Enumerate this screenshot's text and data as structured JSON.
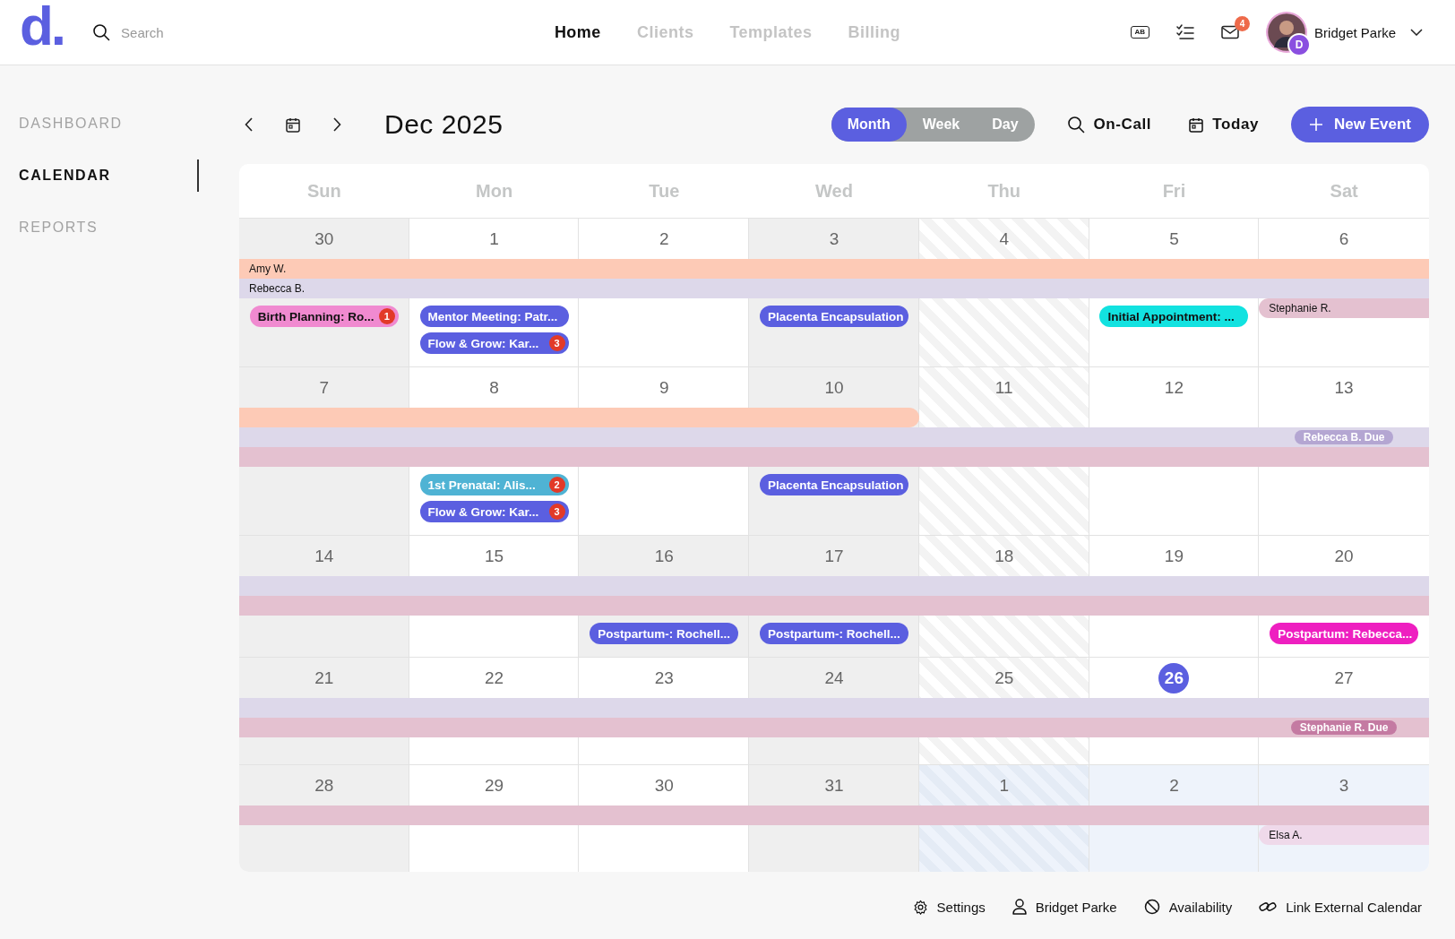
{
  "header": {
    "logo": "d.",
    "search": {
      "placeholder": "Search"
    },
    "nav": [
      {
        "label": "Home",
        "selected": true
      },
      {
        "label": "Clients",
        "selected": false
      },
      {
        "label": "Templates",
        "selected": false
      },
      {
        "label": "Billing",
        "selected": false
      }
    ],
    "tools": [
      {
        "kind": "caption",
        "text": "AB"
      },
      {
        "kind": "checklist"
      },
      {
        "kind": "mail",
        "badge": "4"
      }
    ],
    "user": {
      "initial": "D",
      "name": "Bridget Parke"
    }
  },
  "sidebar": {
    "items": [
      {
        "label": "DASHBOARD",
        "selected": false
      },
      {
        "label": "CALENDAR",
        "selected": true
      },
      {
        "label": "REPORTS",
        "selected": false
      }
    ]
  },
  "toolbar": {
    "title": "Dec 2025",
    "views": [
      {
        "label": "Month",
        "selected": true
      },
      {
        "label": "Week",
        "selected": false
      },
      {
        "label": "Day",
        "selected": false
      }
    ],
    "actions": [
      {
        "kind": "search",
        "label": "On-Call"
      },
      {
        "kind": "calendar",
        "label": "Today"
      }
    ],
    "new_button": "New Event"
  },
  "calendar": {
    "weekdays": [
      "Sun",
      "Mon",
      "Tue",
      "Wed",
      "Thu",
      "Fri",
      "Sat"
    ],
    "weeks": [
      {
        "days": [
          {
            "date": "30",
            "kind": "grey",
            "today": false,
            "events": [
              {
                "title": "Birth Planning: Ro...",
                "color": "#f08ad0",
                "badge": "1"
              }
            ]
          },
          {
            "date": "1",
            "kind": "plain",
            "today": false,
            "events": [
              {
                "title": "Mentor Meeting: Patr...",
                "color": "#5b5fe0"
              },
              {
                "title": "Flow & Grow: Kar...",
                "color": "#5b5fe0",
                "badge": "3"
              }
            ]
          },
          {
            "date": "2",
            "kind": "plain",
            "today": false
          },
          {
            "date": "3",
            "kind": "grey",
            "today": false,
            "events": [
              {
                "title": "Placenta Encapsulation",
                "color": "#5b5fe0"
              }
            ]
          },
          {
            "date": "4",
            "kind": "hatched",
            "today": false
          },
          {
            "date": "5",
            "kind": "plain",
            "today": false,
            "events": [
              {
                "title": "Initial Appointment: ...",
                "color": "#12e2e0"
              }
            ]
          },
          {
            "date": "6",
            "kind": "plain",
            "today": false,
            "stay_start": {
              "label": "Stephanie R.",
              "color": "#e4c1d0"
            }
          }
        ],
        "lanes": [
          {
            "label": "Amy W.",
            "color": "#fdcab6",
            "days": [
              true,
              true,
              true,
              true,
              true,
              true,
              true
            ]
          },
          {
            "label": "Rebecca B.",
            "color": "#ddd8ea",
            "days": [
              true,
              true,
              true,
              true,
              true,
              true,
              true
            ]
          }
        ]
      },
      {
        "days": [
          {
            "date": "7",
            "kind": "grey",
            "today": false
          },
          {
            "date": "8",
            "kind": "plain",
            "today": false,
            "events": [
              {
                "title": "1st Prenatal: Alis...",
                "color": "#4fb3d4",
                "badge": "2"
              },
              {
                "title": "Flow & Grow: Kar...",
                "color": "#5b5fe0",
                "badge": "3"
              }
            ]
          },
          {
            "date": "9",
            "kind": "plain",
            "today": false
          },
          {
            "date": "10",
            "kind": "grey",
            "today": false,
            "events": [
              {
                "title": "Placenta Encapsulation",
                "color": "#5b5fe0"
              }
            ]
          },
          {
            "date": "11",
            "kind": "hatched",
            "today": false
          },
          {
            "date": "12",
            "kind": "plain",
            "today": false
          },
          {
            "date": "13",
            "kind": "plain",
            "today": false
          }
        ],
        "lanes": [
          {
            "color": "#fdcab6",
            "days": [
              true,
              true,
              true,
              true,
              false,
              false,
              false
            ]
          },
          {
            "color": "#ddd8ea",
            "days": [
              true,
              true,
              true,
              true,
              true,
              true,
              true
            ],
            "due": {
              "label": "Rebecca B. Due",
              "color": "#b4a6d2"
            }
          },
          {
            "color": "#e4c1d0",
            "days": [
              true,
              true,
              true,
              true,
              true,
              true,
              true
            ]
          }
        ]
      },
      {
        "days": [
          {
            "date": "14",
            "kind": "grey",
            "today": false
          },
          {
            "date": "15",
            "kind": "plain",
            "today": false
          },
          {
            "date": "16",
            "kind": "grey",
            "today": false,
            "events": [
              {
                "title": "Postpartum-: Rochell...",
                "color": "#5b5fe0"
              }
            ]
          },
          {
            "date": "17",
            "kind": "grey",
            "today": false,
            "events": [
              {
                "title": "Postpartum-: Rochell...",
                "color": "#5b5fe0"
              }
            ]
          },
          {
            "date": "18",
            "kind": "hatched",
            "today": false
          },
          {
            "date": "19",
            "kind": "plain",
            "today": false
          },
          {
            "date": "20",
            "kind": "plain",
            "today": false,
            "events": [
              {
                "title": "Postpartum: Rebecca...",
                "color": "#ee1fc0"
              }
            ]
          }
        ],
        "lanes": [
          {
            "color": "#ddd8ea",
            "days": [
              true,
              true,
              true,
              true,
              true,
              true,
              true
            ]
          },
          {
            "color": "#e4c1d0",
            "days": [
              true,
              true,
              true,
              true,
              true,
              true,
              true
            ]
          }
        ]
      },
      {
        "days": [
          {
            "date": "21",
            "kind": "grey",
            "today": false
          },
          {
            "date": "22",
            "kind": "plain",
            "today": false
          },
          {
            "date": "23",
            "kind": "plain",
            "today": false
          },
          {
            "date": "24",
            "kind": "grey",
            "today": false
          },
          {
            "date": "25",
            "kind": "hatched",
            "today": false
          },
          {
            "date": "26",
            "kind": "plain",
            "today": true
          },
          {
            "date": "27",
            "kind": "plain",
            "today": false
          }
        ],
        "lanes": [
          {
            "color": "#ddd8ea",
            "days": [
              true,
              true,
              true,
              true,
              true,
              true,
              true
            ]
          },
          {
            "color": "#e4c1d0",
            "days": [
              true,
              true,
              true,
              true,
              true,
              true,
              true
            ],
            "due": {
              "label": "Stephanie R. Due",
              "color": "#c47aa2"
            }
          }
        ]
      },
      {
        "days": [
          {
            "date": "28",
            "kind": "grey",
            "today": false
          },
          {
            "date": "29",
            "kind": "plain",
            "today": false
          },
          {
            "date": "30",
            "kind": "plain",
            "today": false
          },
          {
            "date": "31",
            "kind": "grey",
            "today": false
          },
          {
            "date": "1",
            "kind": "outside-hatched",
            "today": false
          },
          {
            "date": "2",
            "kind": "outside",
            "today": false
          },
          {
            "date": "3",
            "kind": "outside",
            "today": false,
            "stay_start": {
              "label": "Elsa A.",
              "color": "#efd9ea"
            }
          }
        ],
        "lanes": [
          {
            "color": "#e4c1d0",
            "days": [
              true,
              true,
              true,
              true,
              true,
              true,
              true
            ]
          }
        ]
      }
    ]
  },
  "footer": {
    "links": [
      {
        "kind": "settings",
        "label": "Settings"
      },
      {
        "kind": "person",
        "label": "Bridget Parke"
      },
      {
        "kind": "unavailable",
        "label": "Availability"
      },
      {
        "kind": "link",
        "label": "Link External Calendar"
      }
    ]
  }
}
